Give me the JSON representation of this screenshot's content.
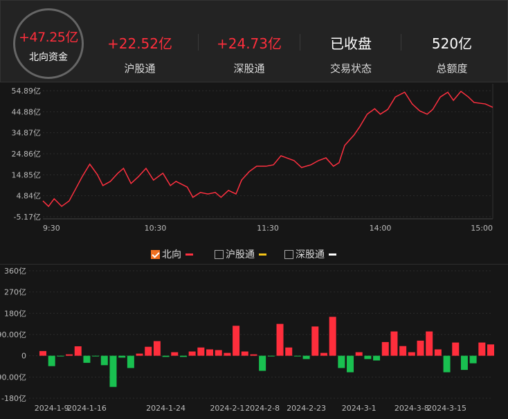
{
  "header": {
    "northbound": {
      "value": "+47.25亿",
      "label": "北向资金"
    },
    "stats": [
      {
        "value": "+22.52亿",
        "label": "沪股通",
        "color": "#ff2e3c"
      },
      {
        "value": "+24.73亿",
        "label": "深股通",
        "color": "#ff2e3c"
      },
      {
        "value": "已收盘",
        "label": "交易状态",
        "color": "#ffffff"
      },
      {
        "value": "520亿",
        "label": "总额度",
        "color": "#ffffff"
      }
    ]
  },
  "legend": [
    {
      "label": "北向",
      "checked": true,
      "color": "#ff3040"
    },
    {
      "label": "沪股通",
      "checked": false,
      "color": "#f5c518"
    },
    {
      "label": "深股通",
      "checked": false,
      "color": "#ffffff"
    }
  ],
  "chart_data": [
    {
      "type": "line",
      "title": "北向资金 intraday",
      "x_unit": "trading minutes from 9:30",
      "yticks": [
        "54.89亿",
        "44.88亿",
        "34.87亿",
        "24.86亿",
        "14.85亿",
        "4.84亿",
        "-5.17亿"
      ],
      "ylim": [
        -5.17,
        54.89
      ],
      "xticks": [
        "9:30",
        "10:30",
        "11:30",
        "14:00",
        "15:00"
      ],
      "series": [
        {
          "name": "北向",
          "color": "#ff3040",
          "x": [
            0,
            3,
            6,
            10,
            14,
            18,
            21,
            25,
            29,
            32,
            36,
            40,
            43,
            47,
            51,
            55,
            59,
            64,
            68,
            71,
            77,
            80,
            84,
            88,
            92,
            95,
            99,
            103,
            106,
            110,
            114,
            119,
            123,
            127,
            130,
            134,
            138,
            143,
            147,
            151,
            155,
            158,
            161,
            166,
            169,
            173,
            177,
            180,
            184,
            188,
            193,
            197,
            201,
            205,
            208,
            212,
            216,
            219,
            223,
            227,
            230,
            236,
            240
          ],
          "y": [
            2.4,
            -0.2,
            3.4,
            -0.2,
            2.4,
            9.0,
            14.0,
            19.9,
            15.0,
            9.7,
            11.7,
            15.6,
            17.9,
            10.7,
            14.0,
            17.9,
            12.3,
            15.6,
            9.7,
            11.7,
            9.0,
            4.1,
            6.4,
            5.7,
            6.4,
            4.1,
            7.4,
            5.7,
            12.3,
            16.3,
            18.9,
            18.9,
            19.6,
            23.9,
            22.9,
            21.6,
            18.3,
            19.6,
            21.6,
            22.9,
            18.9,
            20.6,
            28.8,
            33.8,
            37.7,
            43.7,
            46.3,
            43.7,
            46.0,
            51.9,
            54.2,
            48.6,
            45.3,
            43.7,
            46.0,
            51.9,
            54.2,
            50.3,
            54.6,
            51.9,
            49.3,
            48.6,
            47.0
          ]
        }
      ]
    },
    {
      "type": "bar",
      "title": "北向资金 daily net inflow",
      "yticks": [
        "360亿",
        "270亿",
        "180亿",
        "90.00亿",
        "0",
        "-90.00亿",
        "-180亿"
      ],
      "ylim": [
        -180,
        360
      ],
      "xticks": [
        "2024-1-9",
        "2024-1-16",
        "2024-1-24",
        "2024-2-1",
        "2024-2-8",
        "2024-2-23",
        "2024-3-1",
        "2024-3-8",
        "2024-3-15"
      ],
      "xtick_index": [
        1,
        5,
        14,
        21,
        25,
        30,
        36,
        42,
        46
      ],
      "values": [
        20,
        -44,
        -3,
        6,
        40,
        -30,
        -2,
        -40,
        -132,
        -8,
        -52,
        9,
        38,
        62,
        -5,
        15,
        -5,
        18,
        35,
        27,
        24,
        12,
        127,
        18,
        6,
        -64,
        -2,
        135,
        35,
        -2,
        -14,
        124,
        12,
        165,
        -52,
        -70,
        15,
        -14,
        -20,
        58,
        103,
        41,
        15,
        64,
        103,
        27,
        -70,
        56,
        -60,
        -32,
        56,
        48
      ],
      "colors": {
        "positive": "#ff2e3c",
        "negative": "#19c050"
      }
    }
  ]
}
